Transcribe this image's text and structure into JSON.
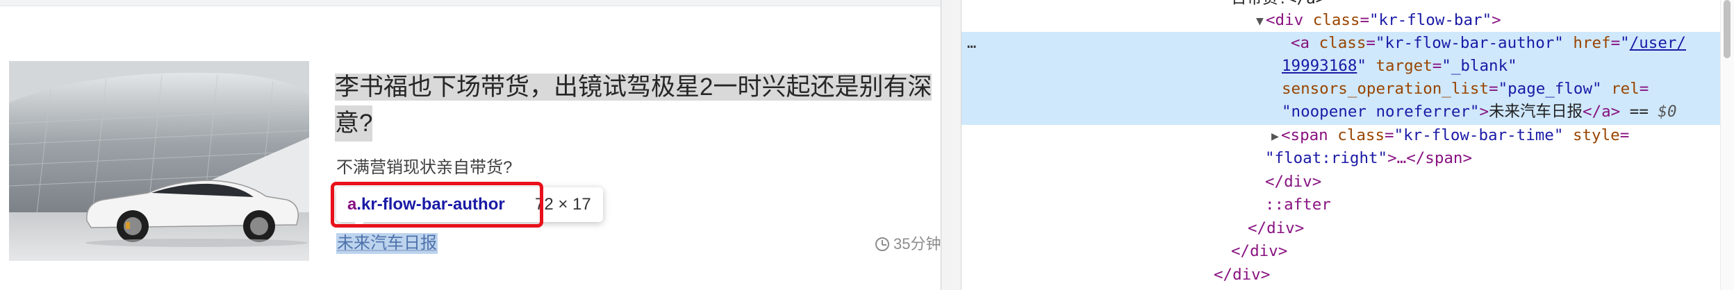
{
  "article": {
    "title_line1": "李书福也下场带货，出镜试驾极星2一时兴起还是别有深",
    "title_line2": "意?",
    "summary": "不满营销现状亲自带货?",
    "author": "未来汽车日报",
    "time": "35分钟"
  },
  "inspector_tooltip": {
    "tag": "a",
    "class": ".kr-flow-bar-author",
    "size": "72 × 17"
  },
  "devtools": {
    "ellipsis": "…",
    "rows": {
      "r0_cut": "日带货!</a>",
      "r1_open": "<div",
      "r1_attr": "class",
      "r1_val": "\"kr-flow-bar\"",
      "r1_close": ">",
      "r2_open": "<a",
      "r2_attr1": "class",
      "r2_val1": "\"kr-flow-bar-author\"",
      "r2_attr2": "href",
      "r2_val2_link": "/user/",
      "r3_link": "19993168",
      "r3_attr": "target",
      "r3_val": "\"_blank\"",
      "r4_attr1": "sensors_operation_list",
      "r4_val1": "\"page_flow\"",
      "r4_attr2": "rel",
      "r5_val": "\"noopener noreferrer\"",
      "r5_text": "未来汽车日报",
      "r5_end": "</a>",
      "r5_eq": "==",
      "r5_dollar": "$0",
      "r6_open": "<span",
      "r6_attr1": "class",
      "r6_val1": "\"kr-flow-bar-time\"",
      "r6_attr2": "style",
      "r7_val": "\"float:right\"",
      "r7_rest": ">…</span>",
      "r8": "</div>",
      "r9": "::after",
      "r10": "</div>",
      "r11": "</div>",
      "r12": "</div>"
    }
  }
}
